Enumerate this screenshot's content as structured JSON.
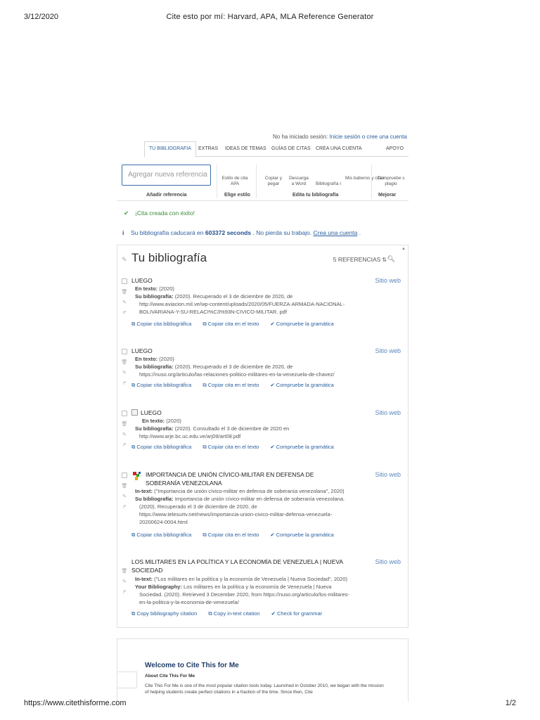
{
  "print": {
    "date": "3/12/2020",
    "title": "Cite esto por mí: Harvard, APA, MLA Reference Generator",
    "url": "https://www.citethisforme.com",
    "page": "1/2"
  },
  "header": {
    "login_text": "No ha iniciado sesión:",
    "login_link": "Inicie sesión o cree una cuenta"
  },
  "tabs": [
    "TU BIBLIOGRAFIA",
    "EXTRAS",
    "IDEAS DE TEMAS",
    "GUÍAS DE CITAS",
    "CREA UNA CUENTA",
    "APOYO"
  ],
  "toolbar": {
    "new_ref_placeholder": "Agregar nueva referencia",
    "add_caption": "Añadir referencia",
    "style_item": "Estilo de cita APA",
    "style_caption": "Elige estilo",
    "copy_paste": "Copiar y pegar",
    "download_word": "Descarga a Word",
    "bibliography": "Bibliografía r",
    "my_bibs": "Mis baberos y citas",
    "edit_caption": "Edita tu bibliografía",
    "plagiarism": "Compruebe s plagio",
    "improve_caption": "Mejorar"
  },
  "alerts": {
    "success": "¡Cita creada con éxito!",
    "info_prefix": "Su bibliografía caducará en",
    "info_seconds": "603372 seconds",
    "info_middle": ". No pierda su trabajo.",
    "info_link": "Crea una cuenta",
    "info_suffix": "."
  },
  "panel": {
    "title": "Tu bibliografía",
    "ref_count": "5 REFERENCIAS"
  },
  "entries": [
    {
      "title": "LUEGO",
      "type": "Sitio web",
      "intext_label": "En texto:",
      "intext": "(2020)",
      "bib_label": "Su bibliografía:",
      "bib_lines": [
        "(2020). Recuperado el 3 de diciembre de 2020, de",
        "http://www.aviacion.mil.ve/wp-content/uploads/2020/05/FUERZA-ARMADA-NACIONAL-",
        "BOLIVARIANA-Y-SU-RELACI%C3%93N-CIVICO-MILITAR. pdf"
      ],
      "actions": [
        "Copiar cita bibliográfica",
        "Copiar cita en el texto",
        "Compruebe la gramática"
      ]
    },
    {
      "title": "LUEGO",
      "type": "Sitio web",
      "intext_label": "En texto:",
      "intext": "(2020)",
      "bib_label": "Su bibliografía:",
      "bib_lines": [
        "(2020). Recuperado el 3 de diciembre de 2020, de",
        "https://nuso.org/articulo/las-relaciones-politico-militares-en-la-venezuela-de-chavez/"
      ],
      "actions": [
        "Copiar cita bibliográfica",
        "Copiar cita en el texto",
        "Compruebe la gramática"
      ]
    },
    {
      "title": "LUEGO",
      "type": "Sitio web",
      "intext_label": "En texto:",
      "intext": "(2020)",
      "bib_label": "Su bibliografía:",
      "bib_lines": [
        "(2020). Consultado el 3 de diciembre de 2020 en",
        "http://www.arje.bc.uc.edu.ve/arj09/art08.pdf"
      ],
      "actions": [
        "Copiar cita bibliográfica",
        "Copiar cita en el texto",
        "Compruebe la gramática"
      ]
    },
    {
      "title_lines": [
        "IMPORTANCIA DE UNIÓN CÍVICO-MILITAR EN DEFENSA DE",
        "SOBERANÍA VENEZOLANA"
      ],
      "type": "Sitio web",
      "intext_label": "In-text:",
      "intext": "(\"Importancia de unión cívico-militar en defensa de soberanía venezolana\", 2020)",
      "bib_label": "Su bibliografía:",
      "bib_lines": [
        "Importancia de unión cívico-militar en defensa de soberanía venezolana.",
        "(2020). Recuperado el 3 de diciembre de 2020, de",
        "https://www.telesurtv.net/news/importancia-union-civico-militar-defensa-venezuela-",
        "20200624-0004.html"
      ],
      "actions": [
        "Copiar cita bibliográfica",
        "Copiar cita en el texto",
        "Compruebe la gramática"
      ]
    },
    {
      "title_lines": [
        "LOS MILITARES EN LA POLÍTICA Y LA ECONOMÍA DE VENEZUELA | NUEVA",
        "SOCIEDAD"
      ],
      "type": "Sitio web",
      "intext_label": "In-text:",
      "intext": "(\"Los militares en la política y la economía de Venezuela | Nueva Sociedad\", 2020)",
      "bib_label": "Your Bibliography:",
      "bib_lines": [
        "Los militares en la política y la economía de Venezuela | Nueva",
        "Sociedad. (2020). Retrieved 3 December 2020, from https://nuso.org/articulo/los-militares-",
        "en-la-politica-y-la-economia-de-venezuela/"
      ],
      "actions": [
        "Copy bibliography citation",
        "Copy in-text citation",
        "Check for grammar"
      ]
    }
  ],
  "welcome": {
    "title": "Welcome to Cite This for Me",
    "about_title": "About Cite This For Me",
    "about_text": "Cite This For Me is one of the most popular citation tools today. Launched in October 2010, we began with the mission of helping students create perfect citations in a fraction of the time. Since then, Cite"
  }
}
